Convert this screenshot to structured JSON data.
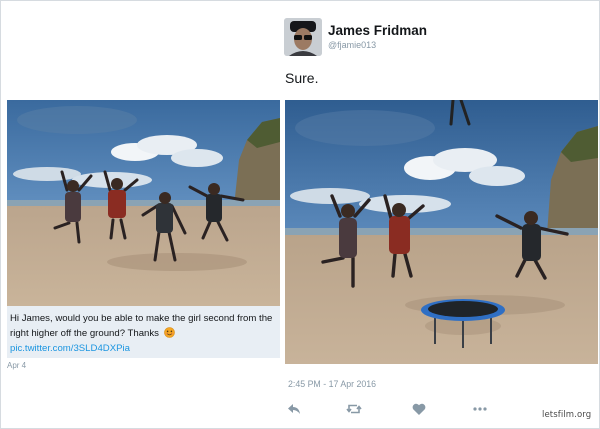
{
  "request_card": {
    "caption_text": "Hi James, would you be able to make the girl second from the right higher off the ground? Thanks",
    "caption_emoji": "smiling-face-emoji",
    "caption_link": "pic.twitter.com/3SLD4DXPia",
    "date": "Apr 4"
  },
  "reply_tweet": {
    "display_name": "James Fridman",
    "username": "@fjamie013",
    "text": "Sure.",
    "timestamp": "2:45 PM - 17 Apr 2016",
    "actions": [
      "reply-icon",
      "retweet-icon",
      "like-icon",
      "more-icon"
    ]
  },
  "watermark": "letsfilm.org",
  "colors": {
    "link": "#1b95e0",
    "muted": "#8899a6",
    "caption_bg": "#e8eef4",
    "trampoline": "#2f6fc4"
  }
}
